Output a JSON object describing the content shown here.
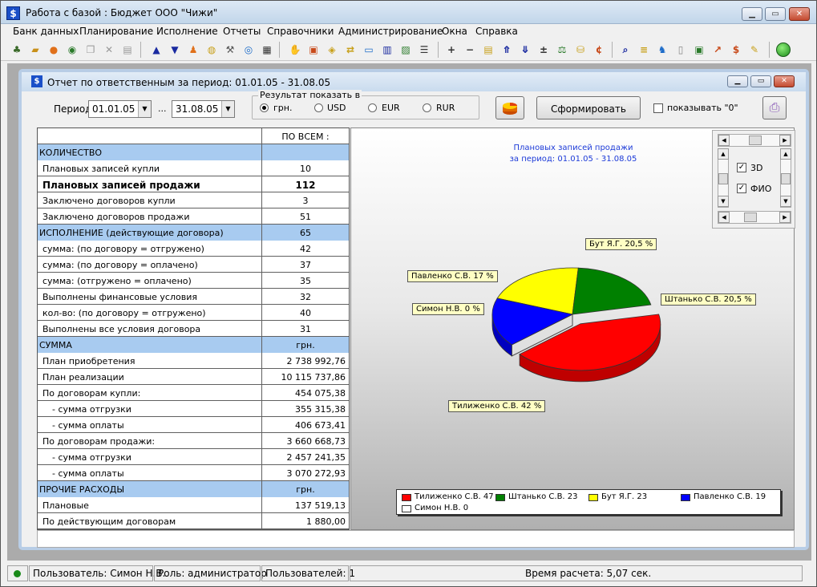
{
  "window": {
    "title": "Работа с базой : Бюджет ООО \"Чижи\"",
    "app_icon": "$"
  },
  "menu": [
    "Банк данных",
    "Планирование",
    "Исполнение",
    "Отчеты",
    "Справочники",
    "Администрирование",
    "Окна",
    "Справка"
  ],
  "child": {
    "title": "Отчет по ответственным за период: 01.01.05 - 31.08.05",
    "period_label": "Период",
    "date_from": "01.01.05",
    "date_sep": "...",
    "date_to": "31.08.05",
    "result_group": "Результат показать в",
    "currencies": [
      "грн.",
      "USD",
      "EUR",
      "RUR"
    ],
    "selected_currency": "грн.",
    "form_button": "Сформировать",
    "show_zero_label": "показывать \"0\"",
    "show_zero_checked": false
  },
  "table": {
    "header": "ПО ВСЕМ :",
    "rows": [
      {
        "label": "КОЛИЧЕСТВО",
        "value": "",
        "type": "section"
      },
      {
        "label": "Плановых записей купли",
        "value": "10",
        "type": "center"
      },
      {
        "label": "Плановых записей продажи",
        "value": "112",
        "type": "bold"
      },
      {
        "label": "Заключено договоров купли",
        "value": "3",
        "type": "center"
      },
      {
        "label": "Заключено договоров продажи",
        "value": "51",
        "type": "center"
      },
      {
        "label": "ИСПОЛНЕНИЕ (действующие договора)",
        "value": "65",
        "type": "section"
      },
      {
        "label": "сумма: (по договору = отгружено)",
        "value": "42",
        "type": "center"
      },
      {
        "label": "сумма: (по договору = оплачено)",
        "value": "37",
        "type": "center"
      },
      {
        "label": "сумма: (отгружено = оплачено)",
        "value": "35",
        "type": "center"
      },
      {
        "label": "Выполнены финансовые условия",
        "value": "32",
        "type": "center"
      },
      {
        "label": "кол-во: (по договору = отгружено)",
        "value": "40",
        "type": "center"
      },
      {
        "label": "Выполнены все условия договора",
        "value": "31",
        "type": "center"
      },
      {
        "label": "СУММА",
        "value": "грн.",
        "type": "section"
      },
      {
        "label": "План приобретения",
        "value": "2 738 992,76",
        "type": "right"
      },
      {
        "label": "План реализации",
        "value": "10 115 737,86",
        "type": "right"
      },
      {
        "label": "По договорам купли:",
        "value": "454 075,38",
        "type": "right"
      },
      {
        "label": "- сумма отгрузки",
        "value": "355 315,38",
        "type": "sub"
      },
      {
        "label": "- сумма оплаты",
        "value": "406 673,41",
        "type": "sub"
      },
      {
        "label": "По договорам продажи:",
        "value": "3 660 668,73",
        "type": "right"
      },
      {
        "label": "- сумма отгрузки",
        "value": "2 457 241,35",
        "type": "sub"
      },
      {
        "label": "- сумма оплаты",
        "value": "3 070 272,93",
        "type": "sub"
      },
      {
        "label": "ПРОЧИЕ РАСХОДЫ",
        "value": "грн.",
        "type": "section"
      },
      {
        "label": "Плановые",
        "value": "137 519,13",
        "type": "right"
      },
      {
        "label": "По действующим договорам",
        "value": "1 880,00",
        "type": "right"
      }
    ]
  },
  "chart_data": {
    "type": "pie",
    "title": "Плановых записей продажи",
    "subtitle": "за период: 01.01.05 - 31.08.05",
    "series": [
      {
        "values": [
          47,
          23,
          23,
          19,
          0
        ]
      }
    ],
    "categories": [
      "Тиличенко С.В.",
      "Штанько С.В.",
      "Бут Я.Г.",
      "Павленко С.В.",
      "Симон Н.В."
    ],
    "colors": [
      "#ff0000",
      "#008000",
      "#ffff00",
      "#0000ff",
      "#ffffff"
    ],
    "slice_labels": [
      "Тилиженко С.В. 42 %",
      "Штанько С.В. 20,5 %",
      "Бут Я.Г. 20,5 %",
      "Павленко С.В. 17 %",
      "Симон Н.В. 0 %"
    ],
    "legend": [
      "Тилиженко С.В. 47",
      "Штанько С.В. 23",
      "Бут Я.Г. 23",
      "Павленко С.В. 19",
      "Симон Н.В. 0"
    ],
    "legend_position": "bottom",
    "is_3d": true
  },
  "chart_options": {
    "opt_3d_label": "3D",
    "opt_3d": true,
    "opt_fio_label": "ФИО",
    "opt_fio": true
  },
  "status": {
    "user": "Пользователь: Симон Н.В.",
    "role": "Роль: администратор",
    "users": "Пользователей: 1",
    "calc_time": "Время расчета: 5,07 сек."
  }
}
